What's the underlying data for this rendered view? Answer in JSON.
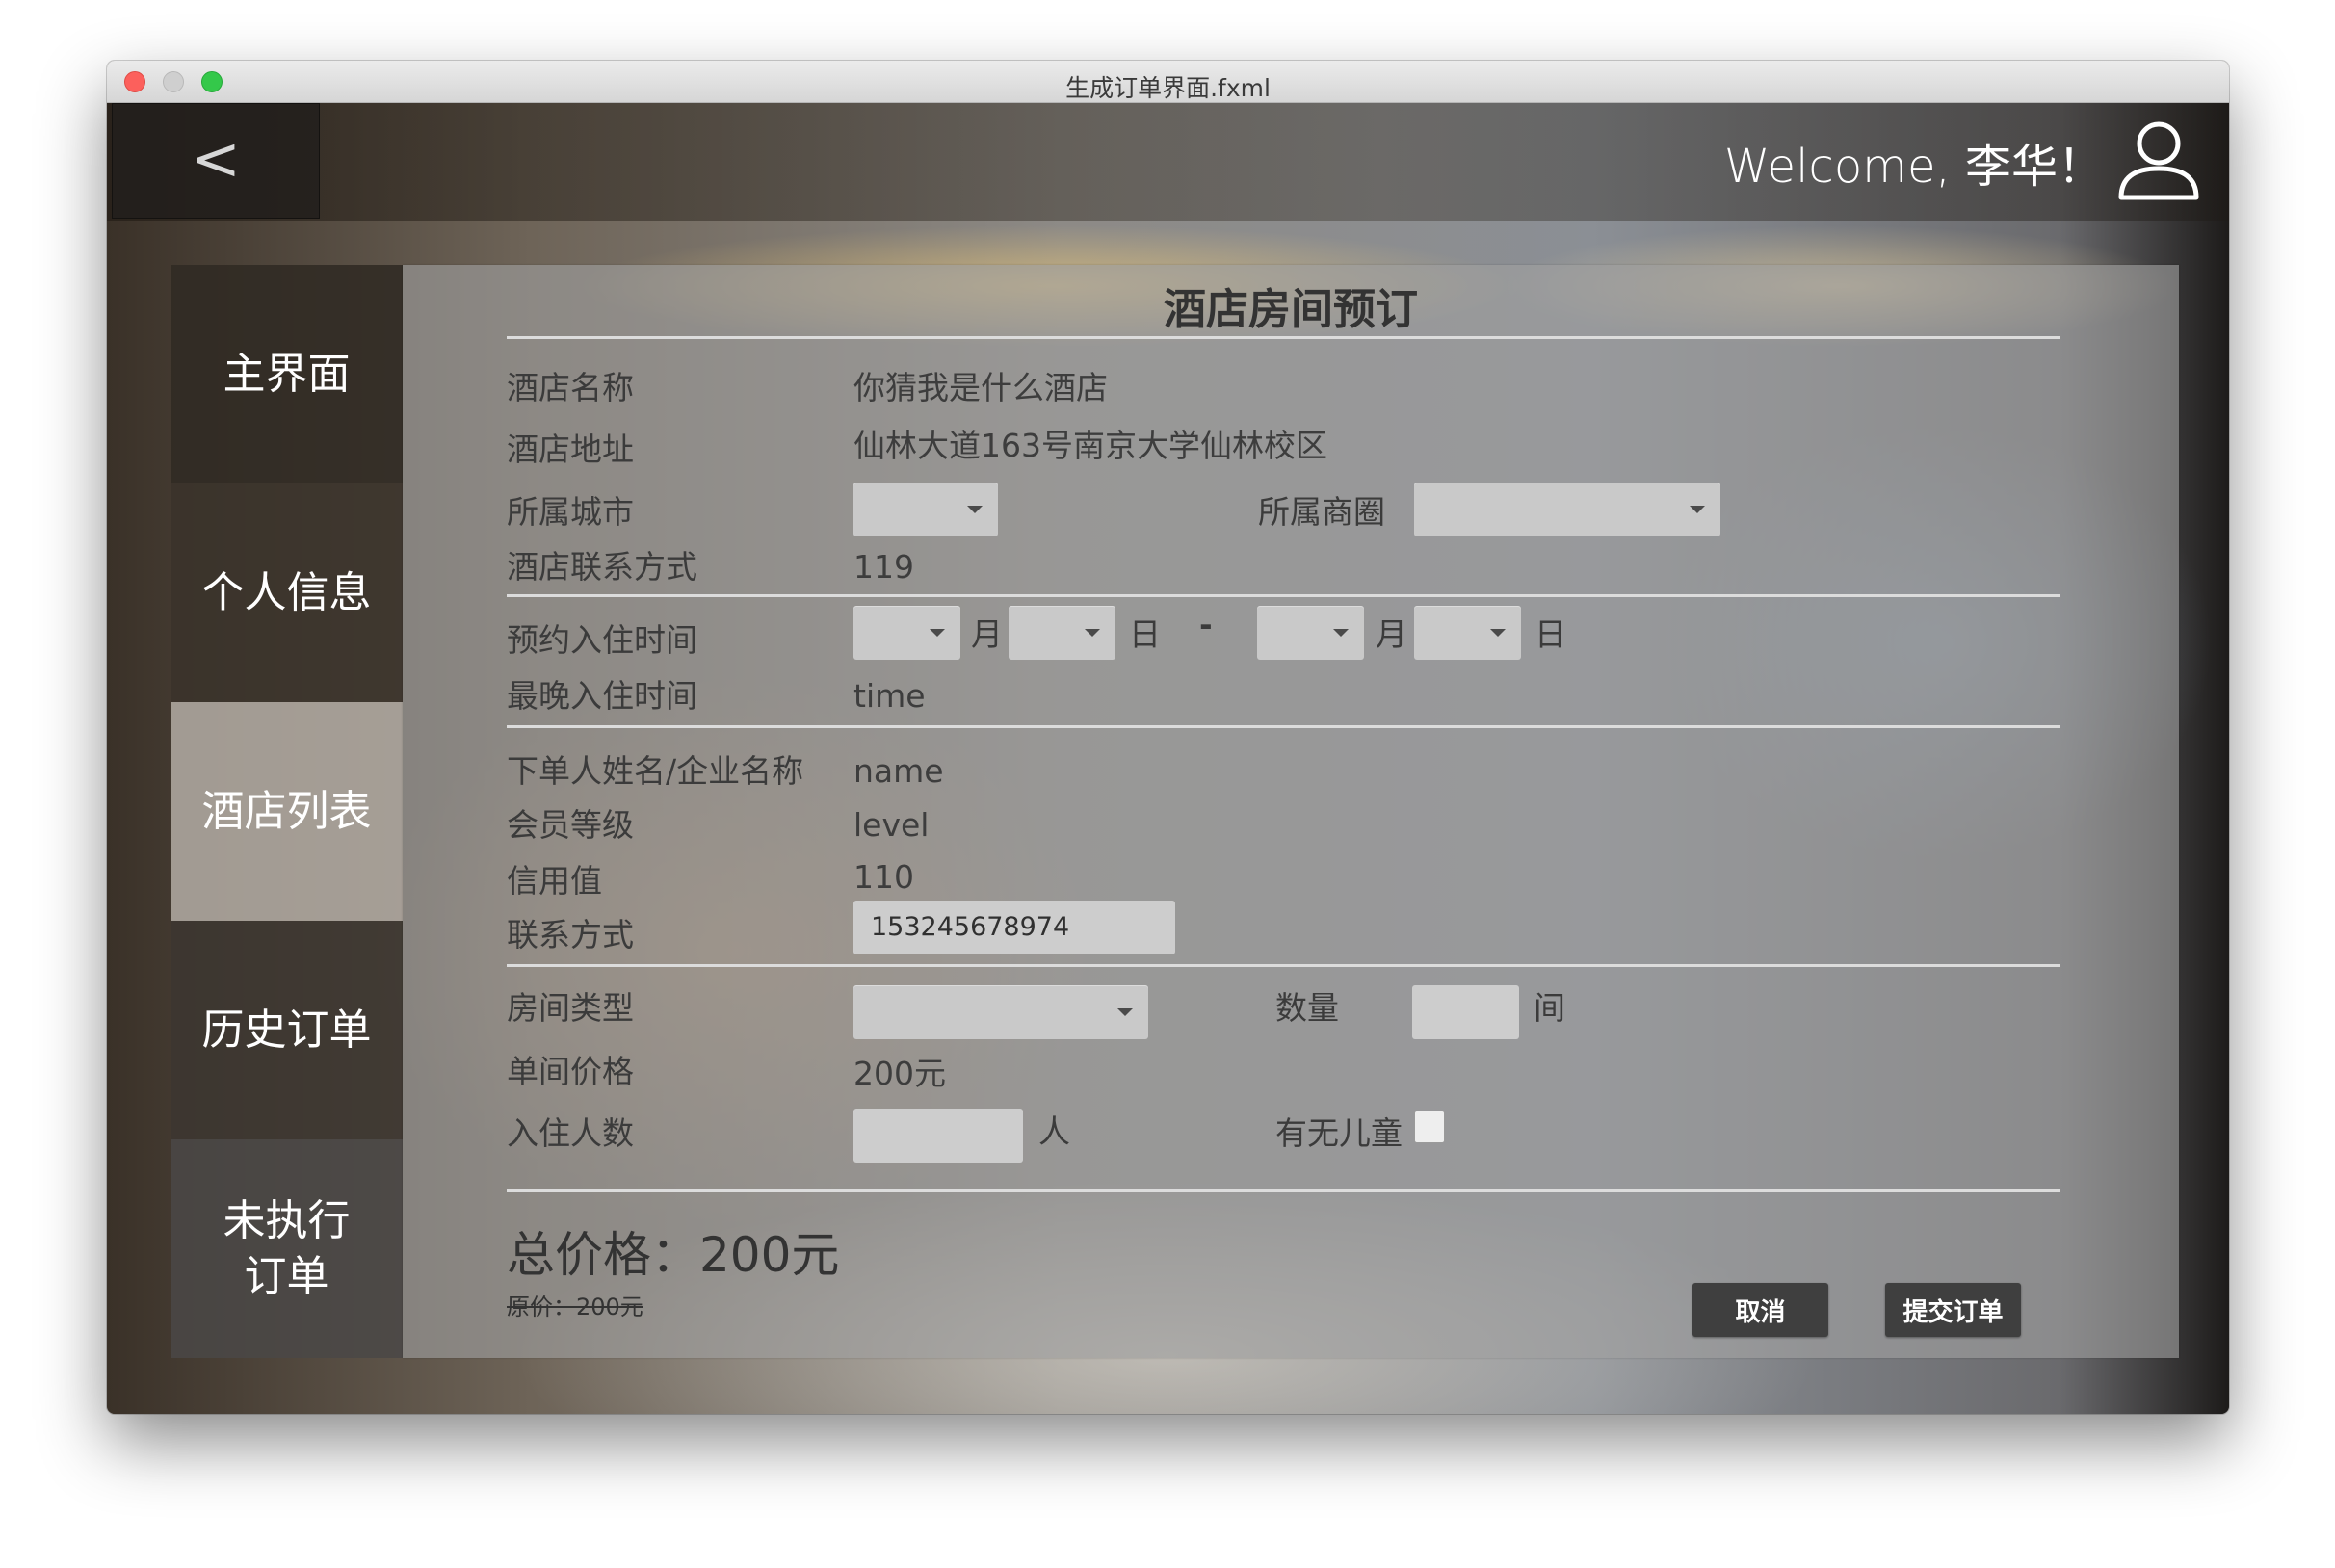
{
  "window": {
    "title": "生成订单界面.fxml"
  },
  "header": {
    "welcome": "Welcome, 李华！"
  },
  "sidebar": {
    "items": [
      {
        "label": "主界面"
      },
      {
        "label": "个人信息"
      },
      {
        "label": "酒店列表"
      },
      {
        "label": "历史订单"
      },
      {
        "label": "未执行\n订单"
      }
    ],
    "active_index": 2
  },
  "form": {
    "title": "酒店房间预订",
    "hotel_name_label": "酒店名称",
    "hotel_name": "你猜我是什么酒店",
    "hotel_address_label": "酒店地址",
    "hotel_address": "仙林大道163号南京大学仙林校区",
    "city_label": "所属城市",
    "city_value": "",
    "district_label": "所属商圈",
    "district_value": "",
    "contact_label": "酒店联系方式",
    "contact": "119",
    "checkin_label": "预约入住时间",
    "month_unit": "月",
    "day_unit": "日",
    "range_sep": "-",
    "latest_label": "最晚入住时间",
    "latest": "time",
    "orderer_label": "下单人姓名/企业名称",
    "orderer": "name",
    "member_label": "会员等级",
    "member": "level",
    "credit_label": "信用值",
    "credit": "110",
    "phone_label": "联系方式",
    "phone": "153245678974",
    "room_type_label": "房间类型",
    "room_type_value": "",
    "quantity_label": "数量",
    "quantity_value": "",
    "room_unit": "间",
    "price_label": "单间价格",
    "price": "200元",
    "guests_label": "入住人数",
    "guests_value": "",
    "person_unit": "人",
    "children_label": "有无儿童",
    "children_checked": false,
    "total": "总价格：200元",
    "original_price": "原价：200元",
    "cancel_label": "取消",
    "submit_label": "提交订单"
  },
  "colors": {
    "close": "#fc605c",
    "minimize": "#cfcfcf",
    "maximize": "#34c84a",
    "button": "#3f3f3f"
  }
}
